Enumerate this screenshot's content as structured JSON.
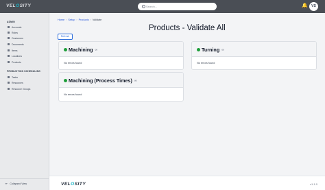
{
  "topbar": {
    "logo_prefix": "VEL",
    "logo_o": "O",
    "logo_suffix": "SITY",
    "search_placeholder": "Search...",
    "avatar_initials": "VS"
  },
  "sidebar": {
    "section_admin": "ADMIN",
    "admin_items": [
      {
        "label": "Accounts"
      },
      {
        "label": "Roles"
      },
      {
        "label": "Customers"
      },
      {
        "label": "Documents"
      },
      {
        "label": "Items"
      },
      {
        "label": "Locations"
      },
      {
        "label": "Products"
      }
    ],
    "section_production": "PRODUCTION SCHEDULING",
    "production_items": [
      {
        "label": "Tasks"
      },
      {
        "label": "Resources"
      },
      {
        "label": "Resource Groups"
      }
    ],
    "collapse_label": "Collapsed View"
  },
  "breadcrumb": {
    "items": [
      "Home",
      "Setup",
      "Products",
      "Validate"
    ]
  },
  "refresh_label": "Refresh",
  "page_title": "Products - Validate All",
  "cards": [
    {
      "title": "Machining",
      "message": "No errors found"
    },
    {
      "title": "Turning",
      "message": "No errors found"
    },
    {
      "title": "Machining (Process Times)",
      "message": "No errors found"
    }
  ],
  "footer": {
    "version": "v1.1.0"
  },
  "colors": {
    "topbar": "#4a4e55",
    "accent": "#19b5c7",
    "primary": "#2f6fdc",
    "status_ok": "#1e9e3a"
  }
}
